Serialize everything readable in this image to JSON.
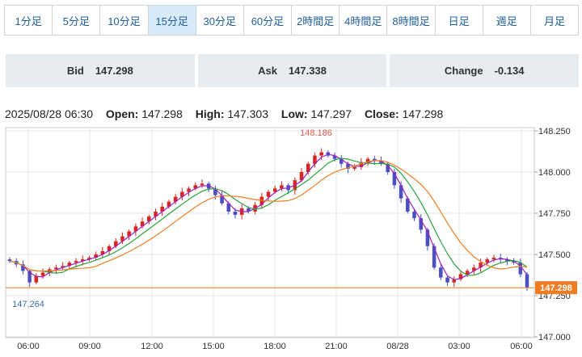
{
  "timeframe_tabs": [
    {
      "label": "1分足"
    },
    {
      "label": "5分足"
    },
    {
      "label": "10分足"
    },
    {
      "label": "15分足",
      "active": true
    },
    {
      "label": "30分足"
    },
    {
      "label": "60分足"
    },
    {
      "label": "2時間足"
    },
    {
      "label": "4時間足"
    },
    {
      "label": "8時間足"
    },
    {
      "label": "日足"
    },
    {
      "label": "週足"
    },
    {
      "label": "月足"
    }
  ],
  "quote": {
    "bid_label": "Bid",
    "bid": "147.298",
    "ask_label": "Ask",
    "ask": "147.338",
    "change_label": "Change",
    "change": "-0.134"
  },
  "ohlc": {
    "datetime": "2025/08/28 06:30",
    "open_label": "Open:",
    "open": "147.298",
    "high_label": "High:",
    "high": "147.303",
    "low_label": "Low:",
    "low": "147.297",
    "close_label": "Close:",
    "close": "147.298"
  },
  "colors": {
    "up": "#d7261e",
    "down": "#4a4fc2",
    "ma_fast": "#9b1fc4",
    "ma_mid": "#27a43a",
    "ma_slow": "#ef7d22",
    "price_line": "#f07c22",
    "grid": "#e4e4e4",
    "tab_active": "#d6eaf7"
  },
  "chart_data": {
    "type": "candlestick",
    "ylim": [
      147.0,
      148.25
    ],
    "y_ticks": [
      "148.250",
      "148.000",
      "147.750",
      "147.500",
      "147.250",
      "147.000"
    ],
    "x_ticks": [
      "06:00",
      "09:00",
      "12:00",
      "15:00",
      "18:00",
      "21:00",
      "08/28",
      "03:00",
      "06:00"
    ],
    "current_price": "147.298",
    "high_marker": "148.186",
    "low_marker": "147.264",
    "series": [
      {
        "name": "close",
        "values": [
          147.46,
          147.44,
          147.4,
          147.33,
          147.37,
          147.39,
          147.41,
          147.42,
          147.43,
          147.45,
          147.46,
          147.47,
          147.48,
          147.5,
          147.52,
          147.55,
          147.58,
          147.61,
          147.64,
          147.67,
          147.7,
          147.73,
          147.76,
          147.79,
          147.82,
          147.85,
          147.88,
          147.9,
          147.92,
          147.93,
          147.9,
          147.86,
          147.81,
          147.76,
          147.74,
          147.78,
          147.76,
          147.8,
          147.85,
          147.88,
          147.9,
          147.92,
          147.89,
          147.95,
          148.0,
          148.05,
          148.1,
          148.12,
          148.1,
          148.08,
          148.05,
          148.02,
          148.03,
          148.06,
          148.08,
          148.07,
          148.05,
          148.0,
          147.92,
          147.84,
          147.76,
          147.72,
          147.65,
          147.55,
          147.42,
          147.36,
          147.33,
          147.35,
          147.38,
          147.4,
          147.42,
          147.45,
          147.47,
          147.48,
          147.47,
          147.46,
          147.45,
          147.38,
          147.3
        ]
      }
    ]
  }
}
